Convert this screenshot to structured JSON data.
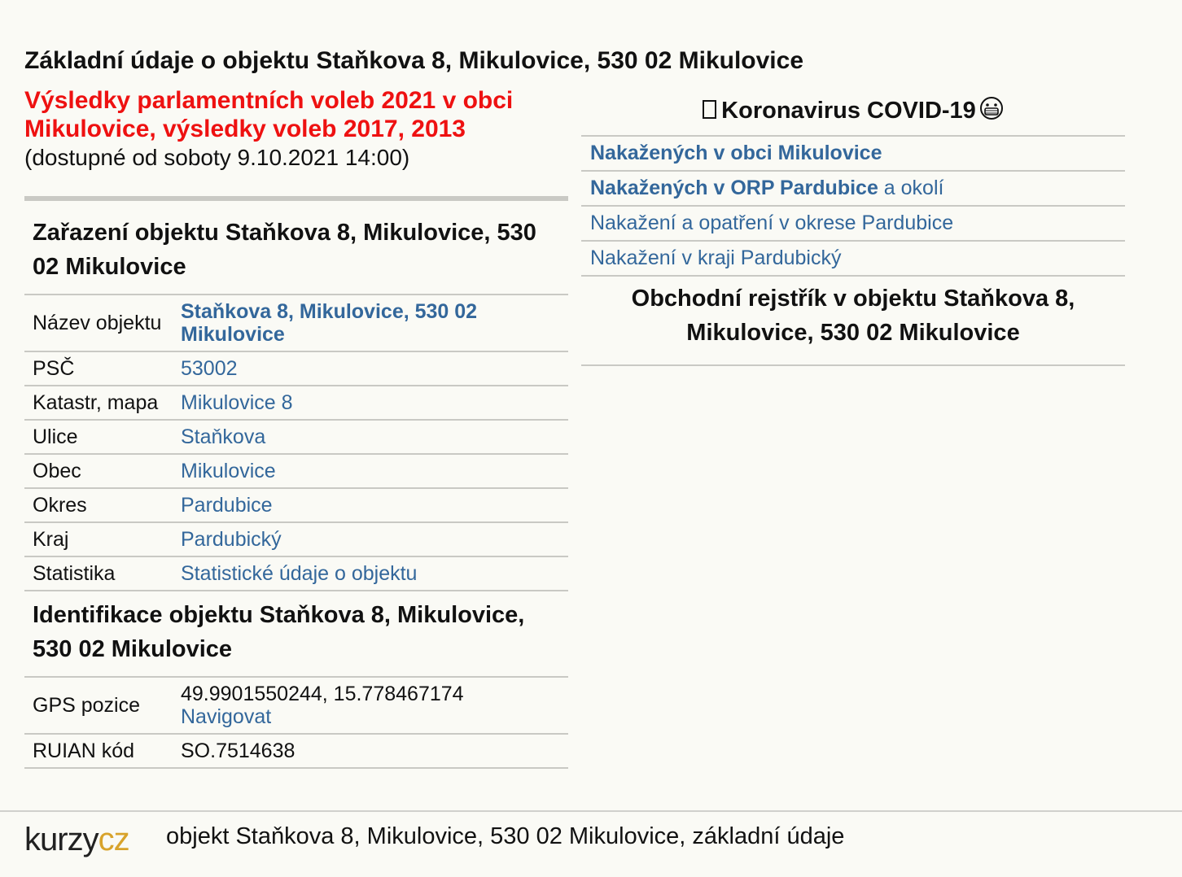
{
  "page": {
    "title": "Základní údaje o objektu Staňkova 8, Mikulovice, 530 02 Mikulovice"
  },
  "elections": {
    "link_text": "Výsledky parlamentních voleb 2021 v obci Mikulovice, výsledky voleb 2017, 2013",
    "availability": "(dostupné od soboty 9.10.2021 14:00)"
  },
  "classification": {
    "heading": "Zařazení objektu Staňkova 8, Mikulovice, 530 02 Mikulovice",
    "rows": [
      {
        "label": "Název objektu",
        "value": "Staňkova 8, Mikulovice, 530 02 Mikulovice"
      },
      {
        "label": "PSČ",
        "value": "53002"
      },
      {
        "label": "Katastr, mapa",
        "value": "Mikulovice 8"
      },
      {
        "label": "Ulice",
        "value": "Staňkova"
      },
      {
        "label": "Obec",
        "value": "Mikulovice"
      },
      {
        "label": "Okres",
        "value": "Pardubice"
      },
      {
        "label": "Kraj",
        "value": "Pardubický"
      },
      {
        "label": "Statistika",
        "value": "Statistické údaje o objektu"
      }
    ]
  },
  "identification": {
    "heading": "Identifikace objektu Staňkova 8, Mikulovice, 530 02 Mikulovice",
    "gps_label": "GPS pozice",
    "gps_value": "49.9901550244, 15.778467174",
    "navigate_label": "Navigovat",
    "ruian_label": "RUIAN kód",
    "ruian_value": "SO.7514638"
  },
  "covid": {
    "title": "Koronavirus COVID-19",
    "items": [
      {
        "bold": "Nakažených v obci Mikulovice",
        "rest": ""
      },
      {
        "bold": "Nakažených v ORP Pardubice",
        "rest": " a okolí"
      },
      {
        "bold": "",
        "rest": "Nakažení a opatření v okrese Pardubice"
      },
      {
        "bold": "",
        "rest": "Nakažení v kraji Pardubický"
      }
    ]
  },
  "business_register": {
    "heading": "Obchodní rejstřík v objektu Staňkova 8, Mikulovice, 530 02 Mikulovice"
  },
  "footer": {
    "logo_part1": "kurzy",
    "logo_part2": "cz",
    "text": "objekt Staňkova 8, Mikulovice, 530 02 Mikulovice, základní údaje"
  },
  "colors": {
    "link": "#33679b",
    "election_red": "#ee1111",
    "logo_accent": "#d8a32b",
    "background": "#fafaf5",
    "separator": "#c9c9c4"
  },
  "icons": [
    "box-icon",
    "mask-face-icon"
  ]
}
